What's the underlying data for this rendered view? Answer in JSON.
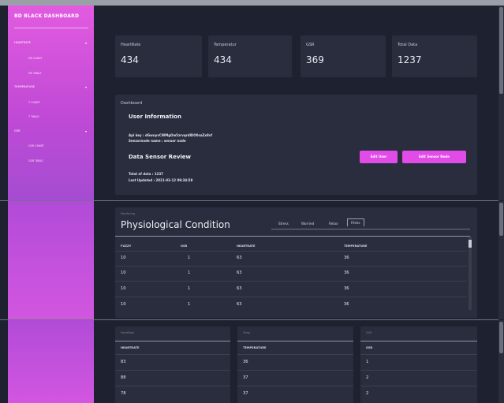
{
  "brand": "BD BLACK DASHBOARD",
  "sidebar": {
    "groups": [
      {
        "label": "HEARTRATE",
        "items": [
          "HR CHART",
          "HR TABLE"
        ]
      },
      {
        "label": "TEMPERATURE",
        "items": [
          "T CHART",
          "T TABLE"
        ]
      },
      {
        "label": "GSR",
        "items": [
          "GSR CHART",
          "GSR TABLE"
        ]
      }
    ],
    "caret": "▾"
  },
  "stats": [
    {
      "label": "HeartRate",
      "value": "434"
    },
    {
      "label": "Temperatur",
      "value": "434"
    },
    {
      "label": "GSR",
      "value": "369"
    },
    {
      "label": "Total Data",
      "value": "1237"
    }
  ],
  "dashboard": {
    "title": "Dashboard",
    "user_info_heading": "User Information",
    "api_key": "Api key : dGwuyvCWMgOw5zrvqrdlDO0saZx8vf",
    "sensornode_name": "Sensornode name : sensor node",
    "review_heading": "Data Sensor Review",
    "total_data": "Total of data : 1237",
    "last_updated": "Last Updated : 2021-03-12 09:34:58",
    "edit_user_label": "Edit User",
    "edit_sensor_label": "Edit Sensor Node"
  },
  "monitoring": {
    "subtitle": "Monitoring",
    "title": "Physiological Condition",
    "tabs": [
      "Stress",
      "Worried",
      "Relax",
      "Fileks"
    ],
    "active_tab": "Fileks",
    "columns": [
      "FUZZY",
      "GSR",
      "HEARTRATE",
      "TEMPERATURE"
    ],
    "rows": [
      [
        "10",
        "1",
        "63",
        "36"
      ],
      [
        "10",
        "1",
        "63",
        "36"
      ],
      [
        "10",
        "1",
        "63",
        "36"
      ],
      [
        "10",
        "1",
        "63",
        "36"
      ]
    ]
  },
  "mini_tables": [
    {
      "subtitle": "HeartRate",
      "column": "HEARTRATE",
      "rows": [
        "83",
        "88",
        "78"
      ]
    },
    {
      "subtitle": "Temp",
      "column": "TEMPERATURE",
      "rows": [
        "36",
        "37",
        "37"
      ]
    },
    {
      "subtitle": "GSR",
      "column": "GSR",
      "rows": [
        "1",
        "2",
        "2"
      ]
    }
  ],
  "colors": {
    "accent": "#e14be8",
    "sidebar": "#d456df",
    "card": "#2a2d3d",
    "background": "#1e2130"
  }
}
